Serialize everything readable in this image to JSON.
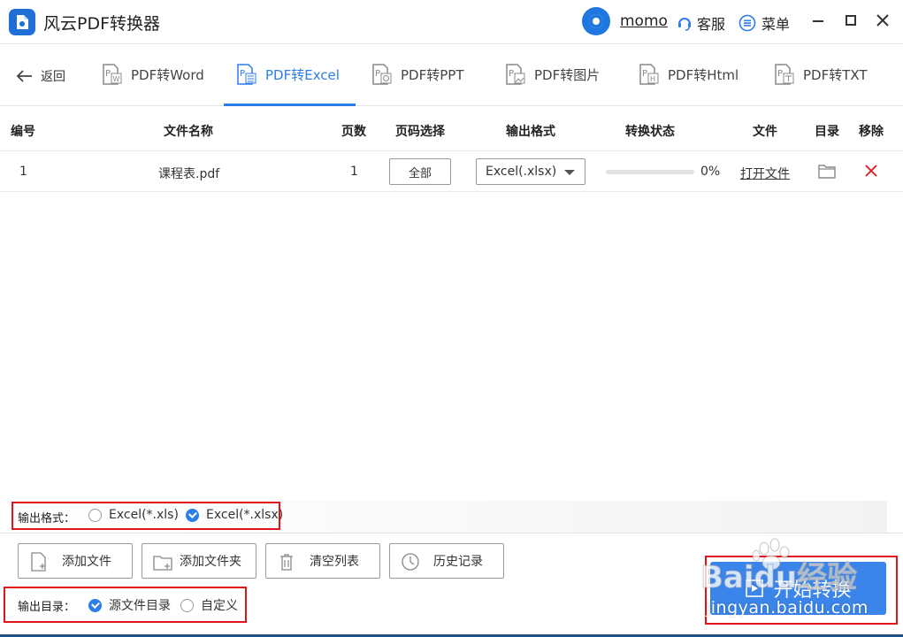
{
  "app": {
    "title": "风云PDF转换器"
  },
  "user": {
    "name": "momo"
  },
  "header": {
    "service_label": "客服",
    "menu_label": "菜单"
  },
  "nav": {
    "back_label": "返回",
    "tabs": [
      {
        "label": "PDF转Word",
        "active": false
      },
      {
        "label": "PDF转Excel",
        "active": true
      },
      {
        "label": "PDF转PPT",
        "active": false
      },
      {
        "label": "PDF转图片",
        "active": false
      },
      {
        "label": "PDF转Html",
        "active": false
      },
      {
        "label": "PDF转TXT",
        "active": false
      }
    ]
  },
  "table": {
    "columns": [
      "编号",
      "文件名称",
      "页数",
      "页码选择",
      "输出格式",
      "转换状态",
      "文件",
      "目录",
      "移除"
    ],
    "rows": [
      {
        "index": "1",
        "file_name": "课程表.pdf",
        "pages": "1",
        "page_select": "全部",
        "output_format": "Excel(.xlsx)",
        "progress": 0,
        "progress_text": "0%",
        "open_file": "打开文件"
      }
    ]
  },
  "output_format": {
    "label": "输出格式：",
    "options": [
      {
        "label": "Excel(*.xls)",
        "selected": false
      },
      {
        "label": "Excel(*.xlsx)",
        "selected": true
      }
    ]
  },
  "actions": {
    "add_file": "添加文件",
    "add_folder": "添加文件夹",
    "clear_list": "清空列表",
    "history": "历史记录"
  },
  "output_dir": {
    "label": "输出目录：",
    "options": [
      {
        "label": "源文件目录",
        "selected": true
      },
      {
        "label": "自定义",
        "selected": false
      }
    ]
  },
  "start": {
    "label": "开始转换"
  },
  "watermark": {
    "brand": "Baidu经验",
    "url": "jingyan.baidu.com"
  },
  "colors": {
    "accent": "#2b7de9",
    "highlight_border": "#e0141a",
    "start_button": "#3a84ea"
  }
}
